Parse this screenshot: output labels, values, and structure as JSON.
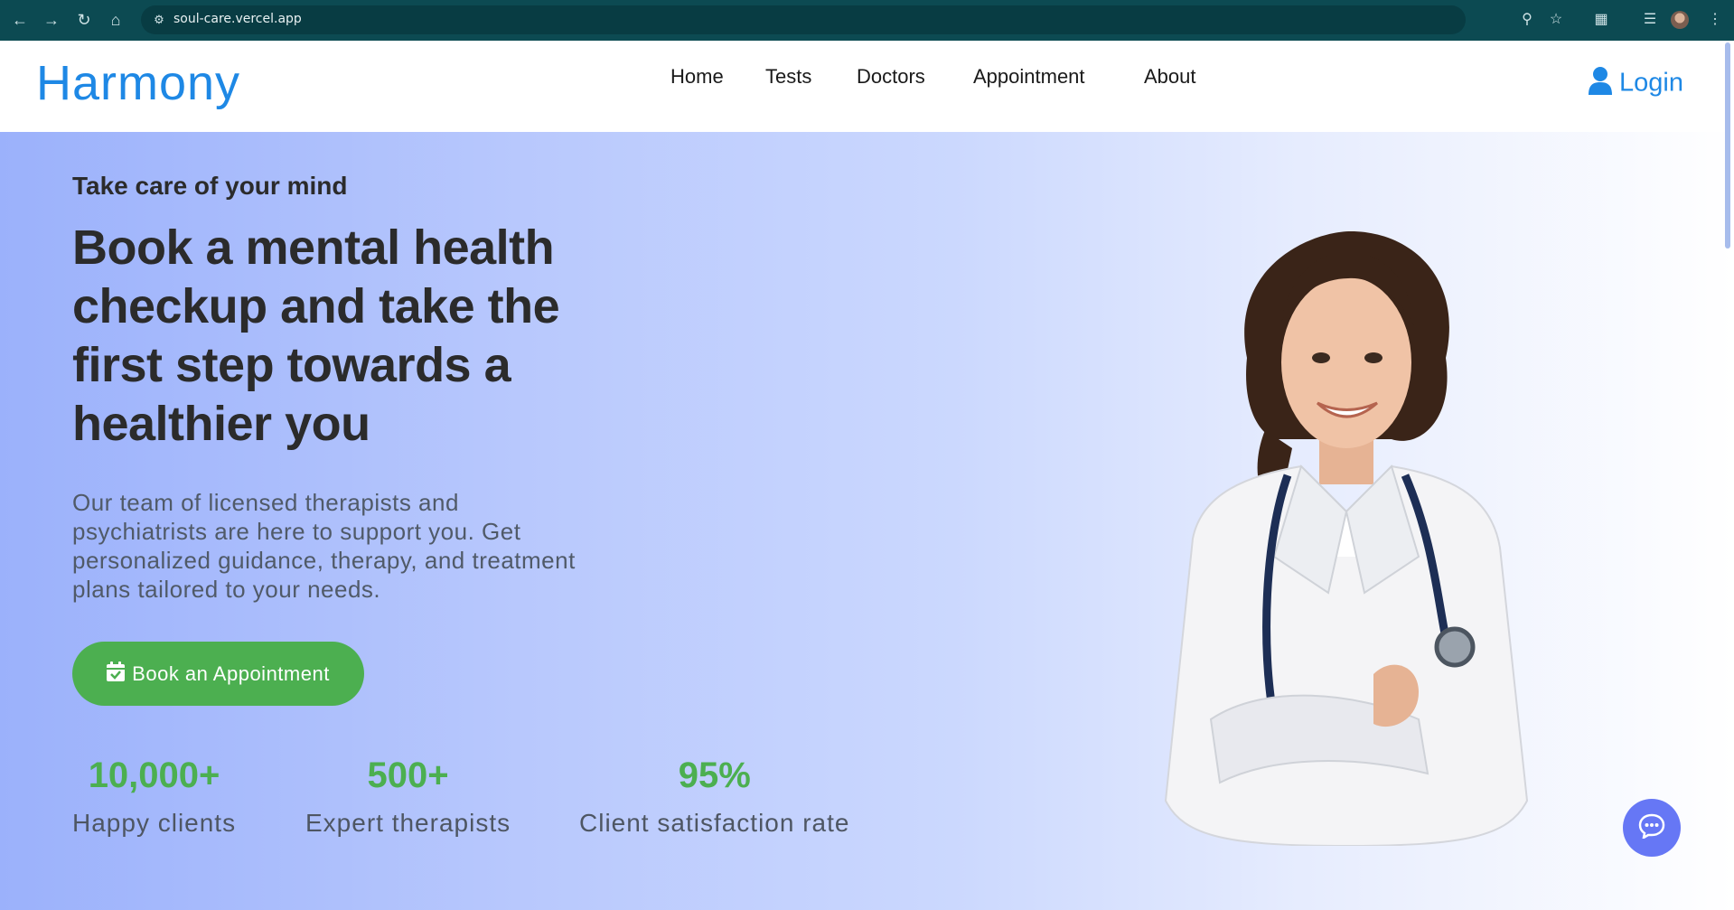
{
  "browser": {
    "url": "soul-care.vercel.app",
    "icons": [
      "back-icon",
      "forward-icon",
      "reload-icon",
      "home-icon",
      "site-info-icon",
      "zoom-icon",
      "bookmark-star-icon",
      "extensions-icon",
      "media-control-icon",
      "profile-avatar",
      "menu-icon"
    ]
  },
  "header": {
    "logo": "Harmony",
    "nav": [
      "Home",
      "Tests",
      "Doctors",
      "Appointment",
      "About"
    ],
    "login": "Login"
  },
  "hero": {
    "eyebrow": "Take care of your mind",
    "headline": "Book a mental health checkup and take the first step towards a healthier you",
    "description": "Our team of licensed therapists and psychiatrists are here to support you. Get personalized guidance, therapy, and treatment plans tailored to your needs.",
    "cta": "Book an Appointment",
    "stats": [
      {
        "value": "10,000+",
        "label": "Happy clients"
      },
      {
        "value": "500+",
        "label": "Expert therapists"
      },
      {
        "value": "95%",
        "label": "Client satisfaction rate"
      }
    ]
  },
  "colors": {
    "brand": "#1e88e5",
    "accent_green": "#4caf50",
    "chat_button": "#6677f5",
    "chrome": "#0c4a52"
  }
}
